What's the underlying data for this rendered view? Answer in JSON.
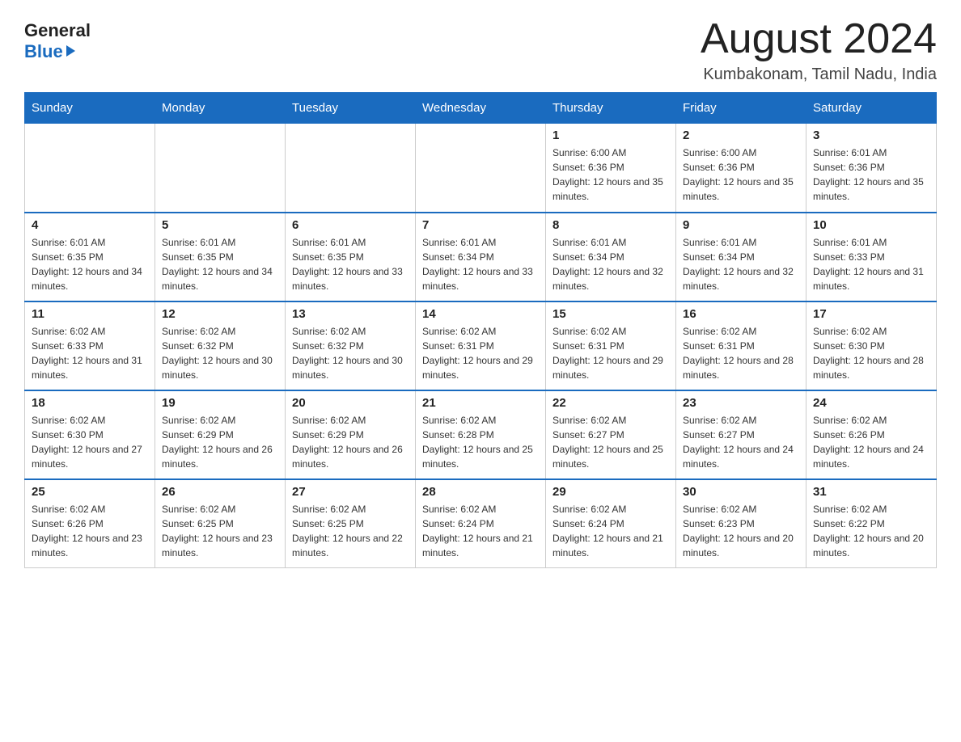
{
  "header": {
    "logo_general": "General",
    "logo_blue": "Blue",
    "title": "August 2024",
    "location": "Kumbakonam, Tamil Nadu, India"
  },
  "calendar": {
    "days_of_week": [
      "Sunday",
      "Monday",
      "Tuesday",
      "Wednesday",
      "Thursday",
      "Friday",
      "Saturday"
    ],
    "weeks": [
      [
        {
          "day": "",
          "info": ""
        },
        {
          "day": "",
          "info": ""
        },
        {
          "day": "",
          "info": ""
        },
        {
          "day": "",
          "info": ""
        },
        {
          "day": "1",
          "info": "Sunrise: 6:00 AM\nSunset: 6:36 PM\nDaylight: 12 hours and 35 minutes."
        },
        {
          "day": "2",
          "info": "Sunrise: 6:00 AM\nSunset: 6:36 PM\nDaylight: 12 hours and 35 minutes."
        },
        {
          "day": "3",
          "info": "Sunrise: 6:01 AM\nSunset: 6:36 PM\nDaylight: 12 hours and 35 minutes."
        }
      ],
      [
        {
          "day": "4",
          "info": "Sunrise: 6:01 AM\nSunset: 6:35 PM\nDaylight: 12 hours and 34 minutes."
        },
        {
          "day": "5",
          "info": "Sunrise: 6:01 AM\nSunset: 6:35 PM\nDaylight: 12 hours and 34 minutes."
        },
        {
          "day": "6",
          "info": "Sunrise: 6:01 AM\nSunset: 6:35 PM\nDaylight: 12 hours and 33 minutes."
        },
        {
          "day": "7",
          "info": "Sunrise: 6:01 AM\nSunset: 6:34 PM\nDaylight: 12 hours and 33 minutes."
        },
        {
          "day": "8",
          "info": "Sunrise: 6:01 AM\nSunset: 6:34 PM\nDaylight: 12 hours and 32 minutes."
        },
        {
          "day": "9",
          "info": "Sunrise: 6:01 AM\nSunset: 6:34 PM\nDaylight: 12 hours and 32 minutes."
        },
        {
          "day": "10",
          "info": "Sunrise: 6:01 AM\nSunset: 6:33 PM\nDaylight: 12 hours and 31 minutes."
        }
      ],
      [
        {
          "day": "11",
          "info": "Sunrise: 6:02 AM\nSunset: 6:33 PM\nDaylight: 12 hours and 31 minutes."
        },
        {
          "day": "12",
          "info": "Sunrise: 6:02 AM\nSunset: 6:32 PM\nDaylight: 12 hours and 30 minutes."
        },
        {
          "day": "13",
          "info": "Sunrise: 6:02 AM\nSunset: 6:32 PM\nDaylight: 12 hours and 30 minutes."
        },
        {
          "day": "14",
          "info": "Sunrise: 6:02 AM\nSunset: 6:31 PM\nDaylight: 12 hours and 29 minutes."
        },
        {
          "day": "15",
          "info": "Sunrise: 6:02 AM\nSunset: 6:31 PM\nDaylight: 12 hours and 29 minutes."
        },
        {
          "day": "16",
          "info": "Sunrise: 6:02 AM\nSunset: 6:31 PM\nDaylight: 12 hours and 28 minutes."
        },
        {
          "day": "17",
          "info": "Sunrise: 6:02 AM\nSunset: 6:30 PM\nDaylight: 12 hours and 28 minutes."
        }
      ],
      [
        {
          "day": "18",
          "info": "Sunrise: 6:02 AM\nSunset: 6:30 PM\nDaylight: 12 hours and 27 minutes."
        },
        {
          "day": "19",
          "info": "Sunrise: 6:02 AM\nSunset: 6:29 PM\nDaylight: 12 hours and 26 minutes."
        },
        {
          "day": "20",
          "info": "Sunrise: 6:02 AM\nSunset: 6:29 PM\nDaylight: 12 hours and 26 minutes."
        },
        {
          "day": "21",
          "info": "Sunrise: 6:02 AM\nSunset: 6:28 PM\nDaylight: 12 hours and 25 minutes."
        },
        {
          "day": "22",
          "info": "Sunrise: 6:02 AM\nSunset: 6:27 PM\nDaylight: 12 hours and 25 minutes."
        },
        {
          "day": "23",
          "info": "Sunrise: 6:02 AM\nSunset: 6:27 PM\nDaylight: 12 hours and 24 minutes."
        },
        {
          "day": "24",
          "info": "Sunrise: 6:02 AM\nSunset: 6:26 PM\nDaylight: 12 hours and 24 minutes."
        }
      ],
      [
        {
          "day": "25",
          "info": "Sunrise: 6:02 AM\nSunset: 6:26 PM\nDaylight: 12 hours and 23 minutes."
        },
        {
          "day": "26",
          "info": "Sunrise: 6:02 AM\nSunset: 6:25 PM\nDaylight: 12 hours and 23 minutes."
        },
        {
          "day": "27",
          "info": "Sunrise: 6:02 AM\nSunset: 6:25 PM\nDaylight: 12 hours and 22 minutes."
        },
        {
          "day": "28",
          "info": "Sunrise: 6:02 AM\nSunset: 6:24 PM\nDaylight: 12 hours and 21 minutes."
        },
        {
          "day": "29",
          "info": "Sunrise: 6:02 AM\nSunset: 6:24 PM\nDaylight: 12 hours and 21 minutes."
        },
        {
          "day": "30",
          "info": "Sunrise: 6:02 AM\nSunset: 6:23 PM\nDaylight: 12 hours and 20 minutes."
        },
        {
          "day": "31",
          "info": "Sunrise: 6:02 AM\nSunset: 6:22 PM\nDaylight: 12 hours and 20 minutes."
        }
      ]
    ]
  }
}
